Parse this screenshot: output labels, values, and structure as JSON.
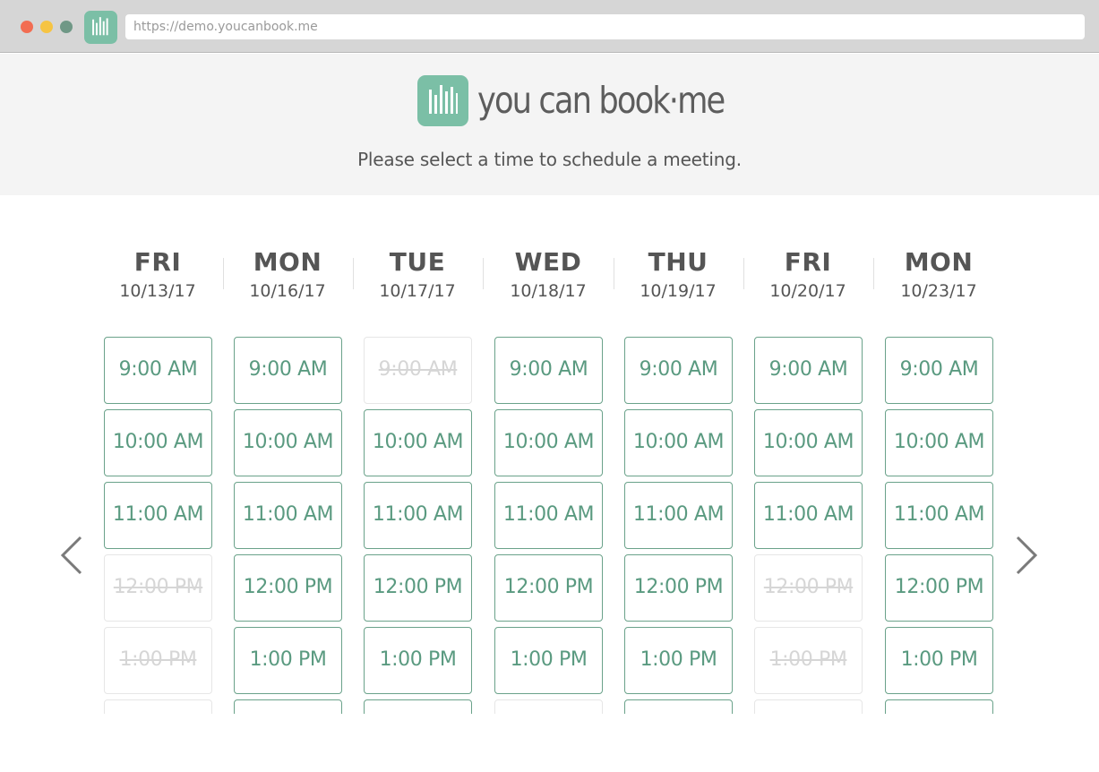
{
  "browser": {
    "url": "https://demo.youcanbook.me"
  },
  "header": {
    "brand": "you can book·me",
    "subtitle": "Please select a time to schedule a meeting."
  },
  "colors": {
    "accent": "#7bbfa6",
    "slot_text": "#5a9a80",
    "slot_border": "#6aa28a",
    "slot_taken": "#d6d6d6"
  },
  "icons": {
    "prev": "chevron-left-icon",
    "next": "chevron-right-icon",
    "logo": "ycbm-logo-icon"
  },
  "days": [
    {
      "name": "FRI",
      "date": "10/13/17",
      "slots": [
        {
          "label": "9:00 AM",
          "available": true
        },
        {
          "label": "10:00 AM",
          "available": true
        },
        {
          "label": "11:00 AM",
          "available": true
        },
        {
          "label": "12:00 PM",
          "available": false
        },
        {
          "label": "1:00 PM",
          "available": false
        },
        {
          "label": "",
          "available": false
        }
      ]
    },
    {
      "name": "MON",
      "date": "10/16/17",
      "slots": [
        {
          "label": "9:00 AM",
          "available": true
        },
        {
          "label": "10:00 AM",
          "available": true
        },
        {
          "label": "11:00 AM",
          "available": true
        },
        {
          "label": "12:00 PM",
          "available": true
        },
        {
          "label": "1:00 PM",
          "available": true
        },
        {
          "label": "",
          "available": true
        }
      ]
    },
    {
      "name": "TUE",
      "date": "10/17/17",
      "slots": [
        {
          "label": "9:00 AM",
          "available": false
        },
        {
          "label": "10:00 AM",
          "available": true
        },
        {
          "label": "11:00 AM",
          "available": true
        },
        {
          "label": "12:00 PM",
          "available": true
        },
        {
          "label": "1:00 PM",
          "available": true
        },
        {
          "label": "",
          "available": true
        }
      ]
    },
    {
      "name": "WED",
      "date": "10/18/17",
      "slots": [
        {
          "label": "9:00 AM",
          "available": true
        },
        {
          "label": "10:00 AM",
          "available": true
        },
        {
          "label": "11:00 AM",
          "available": true
        },
        {
          "label": "12:00 PM",
          "available": true
        },
        {
          "label": "1:00 PM",
          "available": true
        },
        {
          "label": "",
          "available": false
        }
      ]
    },
    {
      "name": "THU",
      "date": "10/19/17",
      "slots": [
        {
          "label": "9:00 AM",
          "available": true
        },
        {
          "label": "10:00 AM",
          "available": true
        },
        {
          "label": "11:00 AM",
          "available": true
        },
        {
          "label": "12:00 PM",
          "available": true
        },
        {
          "label": "1:00 PM",
          "available": true
        },
        {
          "label": "",
          "available": true
        }
      ]
    },
    {
      "name": "FRI",
      "date": "10/20/17",
      "slots": [
        {
          "label": "9:00 AM",
          "available": true
        },
        {
          "label": "10:00 AM",
          "available": true
        },
        {
          "label": "11:00 AM",
          "available": true
        },
        {
          "label": "12:00 PM",
          "available": false
        },
        {
          "label": "1:00 PM",
          "available": false
        },
        {
          "label": "",
          "available": false
        }
      ]
    },
    {
      "name": "MON",
      "date": "10/23/17",
      "slots": [
        {
          "label": "9:00 AM",
          "available": true
        },
        {
          "label": "10:00 AM",
          "available": true
        },
        {
          "label": "11:00 AM",
          "available": true
        },
        {
          "label": "12:00 PM",
          "available": true
        },
        {
          "label": "1:00 PM",
          "available": true
        },
        {
          "label": "",
          "available": true
        }
      ]
    }
  ]
}
